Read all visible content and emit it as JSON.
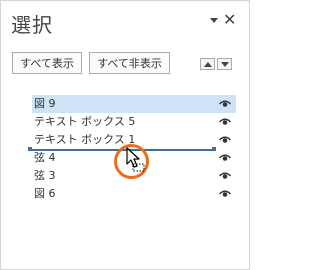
{
  "pane": {
    "title": "選択",
    "buttons": {
      "show_all": "すべて表示",
      "hide_all": "すべて非表示"
    },
    "items": [
      {
        "label": "図 9",
        "selected": true,
        "visible_icon": "eye-icon"
      },
      {
        "label": "テキスト ボックス 5",
        "selected": false,
        "visible_icon": "eye-icon"
      },
      {
        "label": "テキスト ボックス 1",
        "selected": false,
        "visible_icon": "eye-icon"
      },
      {
        "label": "弦 4",
        "selected": false,
        "visible_icon": "eye-icon"
      },
      {
        "label": "弦 3",
        "selected": false,
        "visible_icon": "eye-icon"
      },
      {
        "label": "図 6",
        "selected": false,
        "visible_icon": "eye-icon"
      }
    ]
  },
  "colors": {
    "selection": "#cfe3f6",
    "drop_indicator": "#3f6f9f",
    "highlight": "#f06a1c"
  }
}
